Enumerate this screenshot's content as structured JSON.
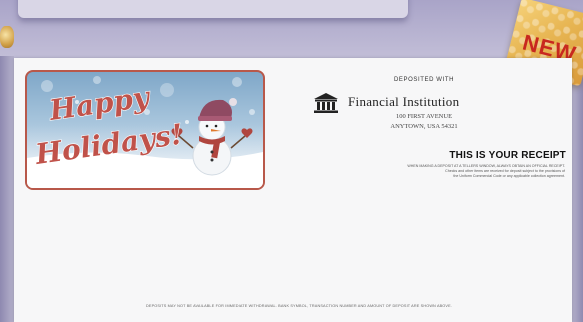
{
  "gift_tag": {
    "text": "NEW"
  },
  "holiday_card": {
    "line1": "Happy",
    "line2": "Holidays!"
  },
  "bank": {
    "deposited_with": "DEPOSITED WITH",
    "name": "Financial Institution",
    "address_line1": "100 FIRST AVENUE",
    "address_line2": "ANYTOWN, USA 54321"
  },
  "receipt": {
    "title": "THIS IS YOUR RECEIPT",
    "disclaimer_line1": "WHEN MAKING A DEPOSIT AT A TELLERS WINDOW, ALWAYS OBTAIN AN OFFICIAL RECEIPT.",
    "disclaimer_line2": "Checks and other items are received for deposit subject to the provisions of",
    "disclaimer_line3": "the Uniform Commercial Code or any applicable collection agreement.",
    "footer": "DEPOSITS MAY NOT BE AVAILABLE FOR IMMEDIATE WITHDRAWAL. BANK SYMBOL, TRANSACTION NUMBER AND AMOUNT OF DEPOSIT ARE SHOWN ABOVE."
  },
  "colors": {
    "frame": "#b8584a",
    "script_text": "#c0524a",
    "background": "#b9b6cf"
  }
}
